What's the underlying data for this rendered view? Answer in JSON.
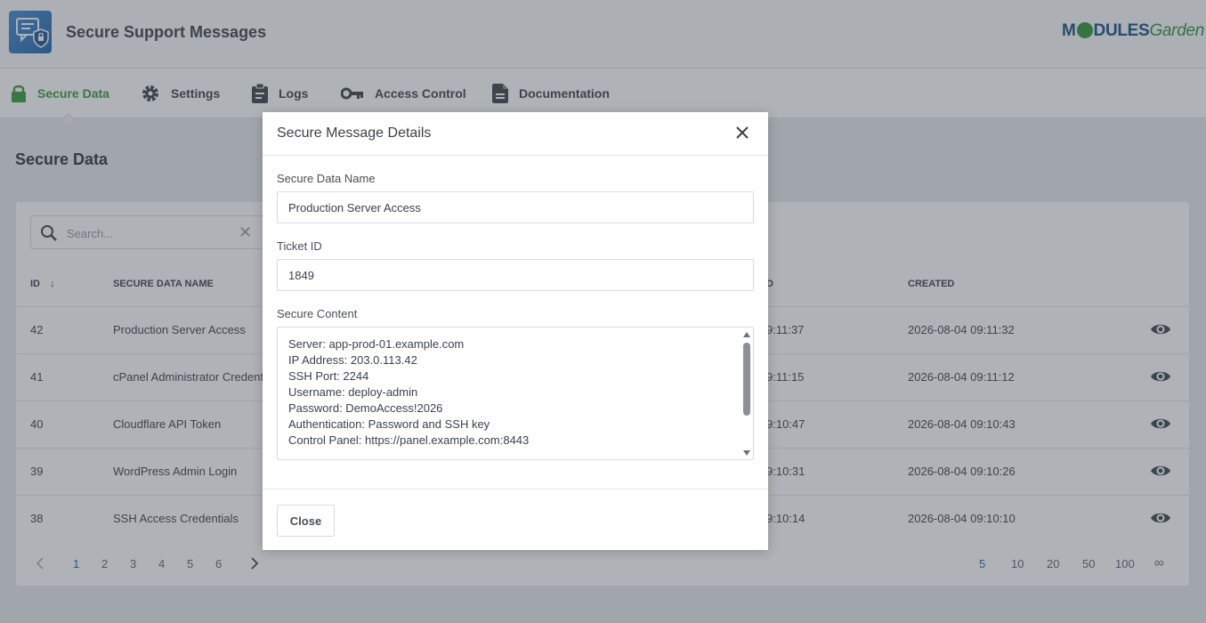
{
  "app": {
    "title": "Secure Support Messages",
    "logo_part1": "M",
    "logo_part2": "DULES",
    "logo_part3": "Garden"
  },
  "nav": {
    "items": [
      {
        "label": "Secure Data",
        "icon": "lock-icon",
        "active": true
      },
      {
        "label": "Settings",
        "icon": "gear-icon"
      },
      {
        "label": "Logs",
        "icon": "clipboard-icon"
      },
      {
        "label": "Access Control",
        "icon": "key-icon"
      },
      {
        "label": "Documentation",
        "icon": "document-icon"
      }
    ]
  },
  "page": {
    "title": "Secure Data"
  },
  "search": {
    "placeholder": "Search..."
  },
  "table": {
    "columns": [
      "ID",
      "Secure Data Name",
      "D",
      "Created"
    ],
    "rows": [
      {
        "id": "42",
        "name": "Production Server Access",
        "updated": "9:11:37",
        "created": "2026-08-04 09:11:32"
      },
      {
        "id": "41",
        "name": "cPanel Administrator Credent",
        "updated": "9:11:15",
        "created": "2026-08-04 09:11:12"
      },
      {
        "id": "40",
        "name": "Cloudflare API Token",
        "updated": "9:10:47",
        "created": "2026-08-04 09:10:43"
      },
      {
        "id": "39",
        "name": "WordPress Admin Login",
        "updated": "9:10:31",
        "created": "2026-08-04 09:10:26"
      },
      {
        "id": "38",
        "name": "SSH Access Credentials",
        "updated": "9:10:14",
        "created": "2026-08-04 09:10:10"
      }
    ]
  },
  "pagination": {
    "pages": [
      "1",
      "2",
      "3",
      "4",
      "5",
      "6"
    ],
    "current": "1",
    "per_page": [
      "5",
      "10",
      "20",
      "50",
      "100",
      "∞"
    ],
    "per_page_current": "5"
  },
  "modal": {
    "title": "Secure Message Details",
    "name_label": "Secure Data Name",
    "name_value": "Production Server Access",
    "ticket_label": "Ticket ID",
    "ticket_value": "1849",
    "content_label": "Secure Content",
    "content_lines": [
      "Server: app-prod-01.example.com",
      "IP Address: 203.0.113.42",
      "SSH Port: 2244",
      "Username: deploy-admin",
      "Password: DemoAccess!2026",
      "Authentication: Password and SSH key",
      "Control Panel: https://panel.example.com:8443"
    ],
    "close_label": "Close"
  },
  "colors": {
    "accent_green": "#43a047",
    "link_blue": "#2f6fb3",
    "overlay": "rgba(45,52,62,0.38)"
  }
}
